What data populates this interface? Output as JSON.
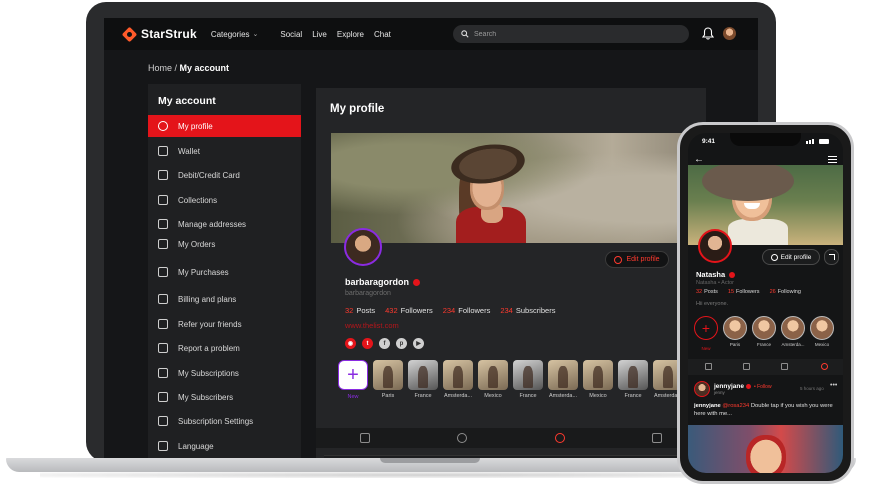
{
  "laptop": {
    "brand": "StarStruk",
    "nav": {
      "categories_label": "Categories",
      "links": [
        "Social",
        "Live",
        "Explore",
        "Chat"
      ]
    },
    "search": {
      "placeholder": "Search"
    },
    "breadcrumb": {
      "home": "Home",
      "separator": " / ",
      "current": "My account"
    },
    "sidebar": {
      "title": "My account",
      "items": [
        "My profile",
        "Wallet",
        "Debit/Credit Card",
        "Collections",
        "Manage addresses",
        "My Orders",
        "My Purchases",
        "Billing and plans",
        "Refer your friends",
        "Report a problem",
        "My Subscriptions",
        "My Subscribers",
        "Subscription Settings",
        "Language"
      ],
      "active_index": 0
    },
    "profile": {
      "title": "My profile",
      "edit_label": "Edit profile",
      "username": "barbaragordon",
      "handle": "barbaragordon",
      "stats": [
        {
          "n": "32",
          "label": "Posts"
        },
        {
          "n": "432",
          "label": "Followers"
        },
        {
          "n": "234",
          "label": "Followers"
        },
        {
          "n": "234",
          "label": "Subscribers"
        }
      ],
      "website": "www.thelist.com",
      "new_label": "New",
      "highlights": [
        "Paris",
        "France",
        "Amsterda...",
        "Mexico",
        "France",
        "Amsterda...",
        "Mexico",
        "France",
        "Amsterda..."
      ]
    }
  },
  "phone": {
    "time": "9:41",
    "edit_label": "Edit profile",
    "name": "Natasha",
    "subtitle": "Natasha • Actor",
    "stats": [
      {
        "n": "32",
        "label": "Posts"
      },
      {
        "n": "15",
        "label": "Followers"
      },
      {
        "n": "26",
        "label": "Following"
      }
    ],
    "bio": "Hii everyone.",
    "new_label": "New",
    "highlights": [
      "Paris",
      "France",
      "Amsterda...",
      "Mexico"
    ],
    "post": {
      "user": "jennyjane",
      "follow_label": "• Follow",
      "handle": "jenny",
      "time": "5 hours ago",
      "caption_user": "jennyjane",
      "caption_tag": "@rosa234",
      "caption_text": " Double tap if you wish you were here with me..."
    }
  },
  "colors": {
    "accent": "#e4141a",
    "accent_text": "#ff3a2e",
    "panel": "#242527",
    "background": "#151618"
  }
}
